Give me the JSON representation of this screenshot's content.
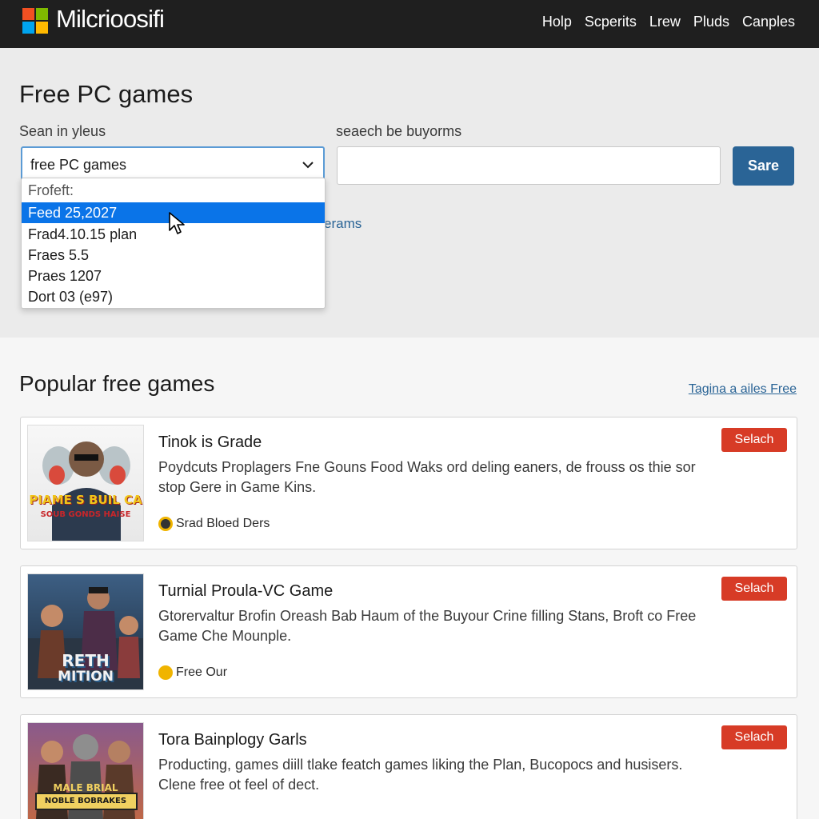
{
  "header": {
    "brand": "Milcrioosifi",
    "logo_colors": [
      "#f25022",
      "#7fba00",
      "#00a4ef",
      "#ffb900"
    ],
    "nav": [
      "Holp",
      "Scperits",
      "Lrew",
      "Pluds",
      "Canples"
    ]
  },
  "search": {
    "title": "Free PC games",
    "left_label": "Sean in yleus",
    "right_label": "seaech be buyorms",
    "select_value": "free PC games",
    "input_value": "",
    "button_label": "Sare",
    "behind_link": "erams",
    "dropdown": {
      "header": "Frofeft:",
      "options": [
        "Feed 25,2027",
        "Frad4.10.15 plan",
        "Fraes 5.5",
        "Praes 1207",
        "Dort 03 (e97)"
      ],
      "selected_index": 0
    }
  },
  "popular": {
    "title": "Popular free games",
    "link": "Tagina a ailes Free",
    "cards": [
      {
        "title": "Tinok is Grade",
        "description": "Poydcuts Proplagers Fne Gouns Food Waks ord deling eaners, de frouss os thie sor stop Gere in Game Kins.",
        "meta": "Srad Bloed Ders",
        "button": "Selach",
        "thumb_caption_1": "PIAME S BUIL CA",
        "thumb_caption_2": "SOUB GONDS HAISE"
      },
      {
        "title": "Turnial Proula-VC Game",
        "description": "Gtorervaltur Brofin Oreash Bab Haum of the Buyour Crine filling Stans, Broft co Free Game Che Mounple.",
        "meta": "Free Our",
        "button": "Selach",
        "thumb_caption_1": "RETH",
        "thumb_caption_2": "MITION"
      },
      {
        "title": "Tora Bainplogy Garls",
        "description": "Producting, games diill tlake featch games liking the Plan, Bucopocs and husisers. Clene free ot feel of dect.",
        "meta": "",
        "button": "Selach",
        "thumb_caption_1": "MALE BRIAL",
        "thumb_caption_2": "NOBLE BOBRAKES"
      }
    ]
  },
  "colors": {
    "topbar": "#1f1f1f",
    "accent_blue": "#2a6496",
    "selection_blue": "#0a74e8",
    "button_red": "#d73b26"
  }
}
